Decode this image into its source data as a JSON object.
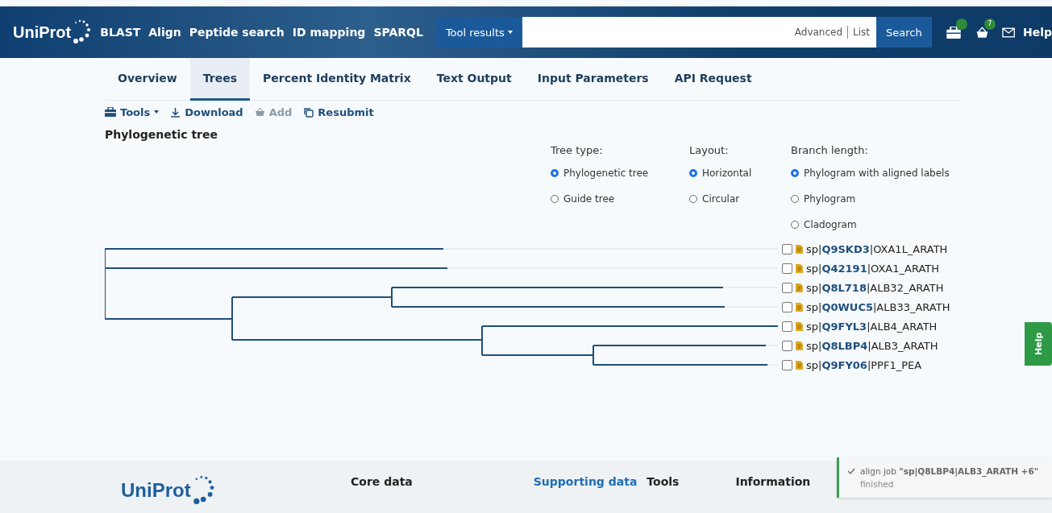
{
  "header": {
    "logo": "UniProt",
    "nav": [
      "BLAST",
      "Align",
      "Peptide search",
      "ID mapping",
      "SPARQL"
    ],
    "tool_results": "Tool results",
    "search": {
      "links": [
        "Advanced",
        "List"
      ],
      "button": "Search"
    },
    "basket_count": "7",
    "help": "Help"
  },
  "tabs": [
    {
      "label": "Overview",
      "selected": false
    },
    {
      "label": "Trees",
      "selected": true
    },
    {
      "label": "Percent Identity Matrix",
      "selected": false
    },
    {
      "label": "Text Output",
      "selected": false
    },
    {
      "label": "Input Parameters",
      "selected": false
    },
    {
      "label": "API Request",
      "selected": false
    }
  ],
  "toolbar": [
    {
      "kind": "tools",
      "label": "Tools",
      "disabled": false
    },
    {
      "kind": "download",
      "label": "Download",
      "disabled": false
    },
    {
      "kind": "add",
      "label": "Add",
      "disabled": true
    },
    {
      "kind": "resubmit",
      "label": "Resubmit",
      "disabled": false
    }
  ],
  "section_title": "Phylogenetic tree",
  "options": [
    {
      "title": "Tree type:",
      "choices": [
        {
          "label": "Phylogenetic tree",
          "selected": true
        },
        {
          "label": "Guide tree",
          "selected": false
        }
      ]
    },
    {
      "title": "Layout:",
      "choices": [
        {
          "label": "Horizontal",
          "selected": true
        },
        {
          "label": "Circular",
          "selected": false
        }
      ]
    },
    {
      "title": "Branch length:",
      "choices": [
        {
          "label": "Phylogram with aligned labels",
          "selected": true
        },
        {
          "label": "Phylogram",
          "selected": false
        },
        {
          "label": "Cladogram",
          "selected": false
        }
      ]
    }
  ],
  "leaves": [
    {
      "db": "sp|",
      "accession": "Q9SKD3",
      "name": "|OXA1L_ARATH",
      "checked": false
    },
    {
      "db": "sp|",
      "accession": "Q42191",
      "name": "|OXA1_ARATH",
      "checked": false
    },
    {
      "db": "sp|",
      "accession": "Q8L718",
      "name": "|ALB32_ARATH",
      "checked": false
    },
    {
      "db": "sp|",
      "accession": "Q0WUC5",
      "name": "|ALB33_ARATH",
      "checked": false
    },
    {
      "db": "sp|",
      "accession": "Q9FYL3",
      "name": "|ALB4_ARATH",
      "checked": false
    },
    {
      "db": "sp|",
      "accession": "Q8LBP4",
      "name": "|ALB3_ARATH",
      "checked": false
    },
    {
      "db": "sp|",
      "accession": "Q9FY06",
      "name": "|PPF1_PEA",
      "checked": false
    }
  ],
  "help_tab": "Help",
  "footer": {
    "logo": "UniProt",
    "columns": [
      {
        "label": "Core data",
        "selected": false
      },
      {
        "label": "Supporting data",
        "selected": true
      },
      {
        "label": "Tools",
        "selected": false
      },
      {
        "label": "Information",
        "selected": false
      }
    ]
  },
  "notification": {
    "message": "align job **\"sp|Q8LBP4|ALB3_ARATH +6\"**",
    "status": "finished"
  }
}
